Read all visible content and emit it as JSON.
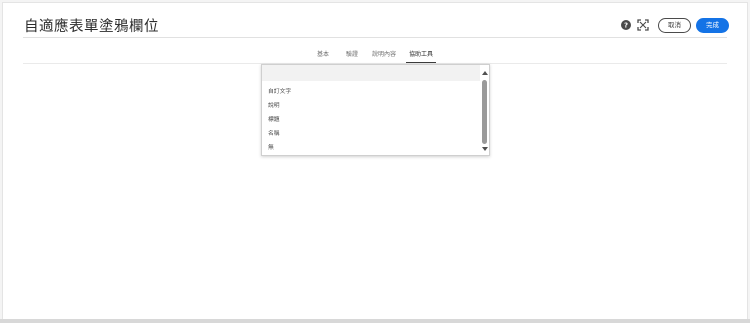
{
  "header": {
    "title": "自適應表單塗鴉欄位",
    "cancel_label": "取消",
    "done_label": "完成",
    "help_icon": "help-icon",
    "fullscreen_icon": "fullscreen-icon"
  },
  "tabs": [
    {
      "label": "基本",
      "active": false
    },
    {
      "label": "驗證",
      "active": false
    },
    {
      "label": "說明內容",
      "active": false
    },
    {
      "label": "協助工具",
      "active": true
    }
  ],
  "dropdown": {
    "selected": "",
    "options": [
      "自訂文字",
      "說明",
      "標題",
      "名稱",
      "無"
    ]
  },
  "colors": {
    "accent": "#1473e6",
    "background": "#f4f4f4",
    "panel": "#ffffff"
  }
}
